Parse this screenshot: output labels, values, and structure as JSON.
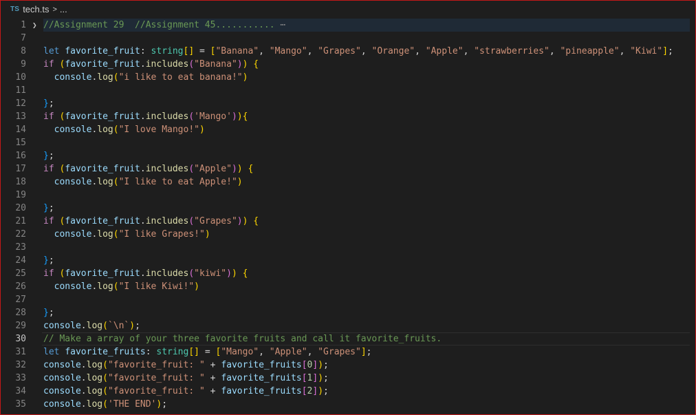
{
  "breadcrumb": {
    "lang_badge": "TS",
    "file": "tech.ts",
    "chevron": ">",
    "more": "..."
  },
  "colors": {
    "keyword": "#569cd6",
    "control": "#c586c0",
    "variable": "#9cdcfe",
    "function": "#dcdcaa",
    "type": "#4ec9b0",
    "string": "#ce9178",
    "number": "#b5cea8",
    "comment": "#6a9955"
  },
  "editor": {
    "active_line": "30",
    "lines": [
      {
        "num": "1",
        "text": "//Assignment 29  //Assignment 45..........."
      },
      {
        "num": "7",
        "text": ""
      },
      {
        "num": "8",
        "text": "let favorite_fruit: string[] = [\"Banana\", \"Mango\", \"Grapes\", \"Orange\", \"Apple\", \"strawberries\", \"pineapple\", \"Kiwi\"];"
      },
      {
        "num": "9",
        "text": "if (favorite_fruit.includes(\"Banana\")) {"
      },
      {
        "num": "10",
        "text": "  console.log(\"i like to eat banana!\")"
      },
      {
        "num": "11",
        "text": ""
      },
      {
        "num": "12",
        "text": "};"
      },
      {
        "num": "13",
        "text": "if (favorite_fruit.includes('Mango')){"
      },
      {
        "num": "14",
        "text": "  console.log(\"I love Mango!\")"
      },
      {
        "num": "15",
        "text": ""
      },
      {
        "num": "16",
        "text": "};"
      },
      {
        "num": "17",
        "text": "if (favorite_fruit.includes(\"Apple\")) {"
      },
      {
        "num": "18",
        "text": "  console.log(\"I like to eat Apple!\")"
      },
      {
        "num": "19",
        "text": ""
      },
      {
        "num": "20",
        "text": "};"
      },
      {
        "num": "21",
        "text": "if (favorite_fruit.includes(\"Grapes\")) {"
      },
      {
        "num": "22",
        "text": "  console.log(\"I like Grapes!\")"
      },
      {
        "num": "23",
        "text": ""
      },
      {
        "num": "24",
        "text": "};"
      },
      {
        "num": "25",
        "text": "if (favorite_fruit.includes(\"kiwi\")) {"
      },
      {
        "num": "26",
        "text": "  console.log(\"I like Kiwi!\")"
      },
      {
        "num": "27",
        "text": ""
      },
      {
        "num": "28",
        "text": "};"
      },
      {
        "num": "29",
        "text": "console.log(`\\n`);"
      },
      {
        "num": "30",
        "text": "// Make a array of your three favorite fruits and call it favorite_fruits."
      },
      {
        "num": "31",
        "text": "let favorite_fruits: string[] = [\"Mango\", \"Apple\", \"Grapes\"];"
      },
      {
        "num": "32",
        "text": "console.log(\"favorite_fruit: \" + favorite_fruits[0]);"
      },
      {
        "num": "33",
        "text": "console.log(\"favorite_fruit: \" + favorite_fruits[1]);"
      },
      {
        "num": "34",
        "text": "console.log(\"favorite_fruit: \" + favorite_fruits[2]);"
      },
      {
        "num": "35",
        "text": "console.log('THE END');"
      }
    ]
  }
}
